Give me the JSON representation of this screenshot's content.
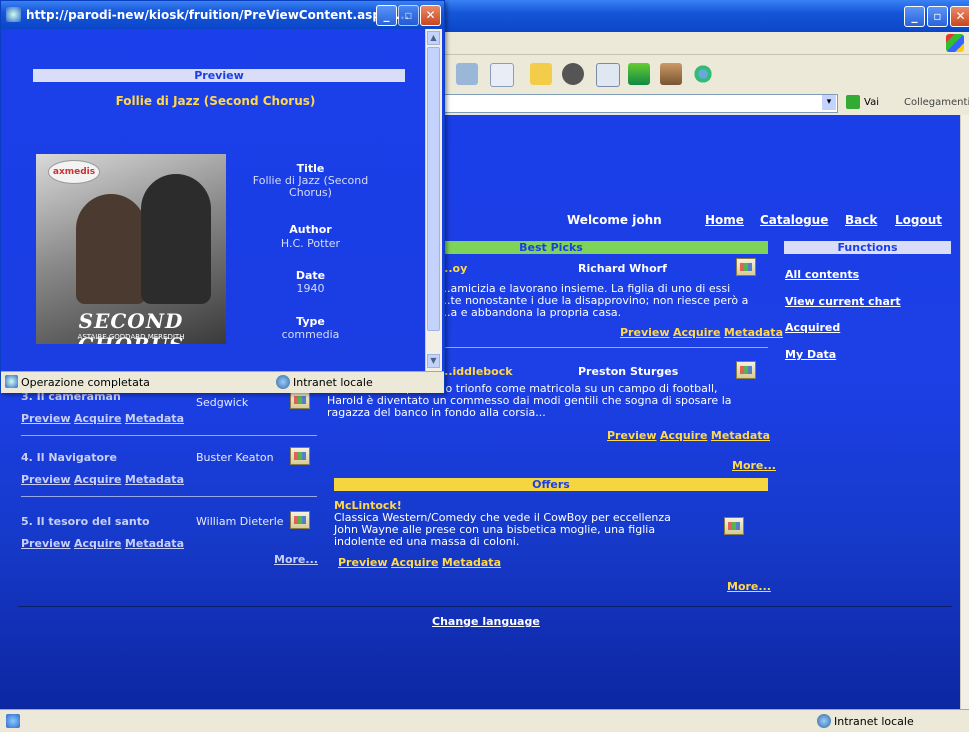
{
  "popup": {
    "title": "http://parodi-new/kiosk/fruition/PreViewContent.aspx?...",
    "section_header": "Preview",
    "content_title": "Follie di Jazz (Second Chorus)",
    "cover": {
      "logo_text": "axmedis",
      "caption": "SECOND CHORUS",
      "credits": "ASTAIRE  GODDARD  MEREDITH"
    },
    "fields": [
      {
        "label": "Title",
        "value": "Follie di Jazz (Second Chorus)"
      },
      {
        "label": "Author",
        "value": "H.C. Potter"
      },
      {
        "label": "Date",
        "value": "1940"
      },
      {
        "label": "Type",
        "value": "commedia"
      }
    ],
    "status_text": "Operazione completata",
    "zone_text": "Intranet locale"
  },
  "main": {
    "address_go": "Vai",
    "address_links": "Collegamenti",
    "status_zone": "Intranet locale",
    "welcome": "Welcome john",
    "nav": {
      "home": "Home",
      "catalogue": "Catalogue",
      "back": "Back",
      "logout": "Logout"
    },
    "best_picks": {
      "header": "Best Picks",
      "items": [
        {
          "title": "...oy",
          "author": "Richard Whorf",
          "description_lines": [
            "...amicizia e lavorano insieme. La figlia di uno di essi",
            "...te nonostante i due la disapprovino; non riesce però a",
            "...a e abbandona la propria casa."
          ]
        },
        {
          "title": "...iddlebock",
          "author": "Preston Sturges",
          "description_lines": [
            "...vent'anni dopo il suo trionfo come matricola su un campo di football,",
            "Harold è diventato un commesso dai modi gentili che sogna di sposare la",
            "ragazza del banco in fondo alla corsia..."
          ]
        }
      ],
      "more": "More..."
    },
    "offers": {
      "header": "Offers",
      "item": {
        "title": "McLintock!",
        "description_lines": [
          "Classica Western/Comedy che vede il CowBoy per eccellenza",
          "John Wayne alle prese con una bisbetica moglie, una figlia",
          "indolente ed una massa di coloni."
        ]
      },
      "more": "More..."
    },
    "left_list": {
      "items": [
        {
          "title": "3. Il cameraman",
          "author": "Sedgwick"
        },
        {
          "title": "4. Il Navigatore",
          "author": "Buster Keaton"
        },
        {
          "title": "5. Il tesoro del santo",
          "author": "William Dieterle"
        }
      ],
      "more": "More..."
    },
    "functions": {
      "header": "Functions",
      "items": [
        "All contents",
        "View current chart",
        "Acquired",
        "My Data"
      ]
    },
    "actions": {
      "preview": "Preview",
      "acquire": "Acquire",
      "metadata": "Metadata"
    },
    "change_language": "Change language"
  },
  "colors": {
    "page_blue": "#1a3ee8",
    "best_picks_bar": "#7ed35a",
    "offers_bar": "#f5d640",
    "functions_bar": "#d9ddf7",
    "link_yellow": "#ffd84b"
  }
}
